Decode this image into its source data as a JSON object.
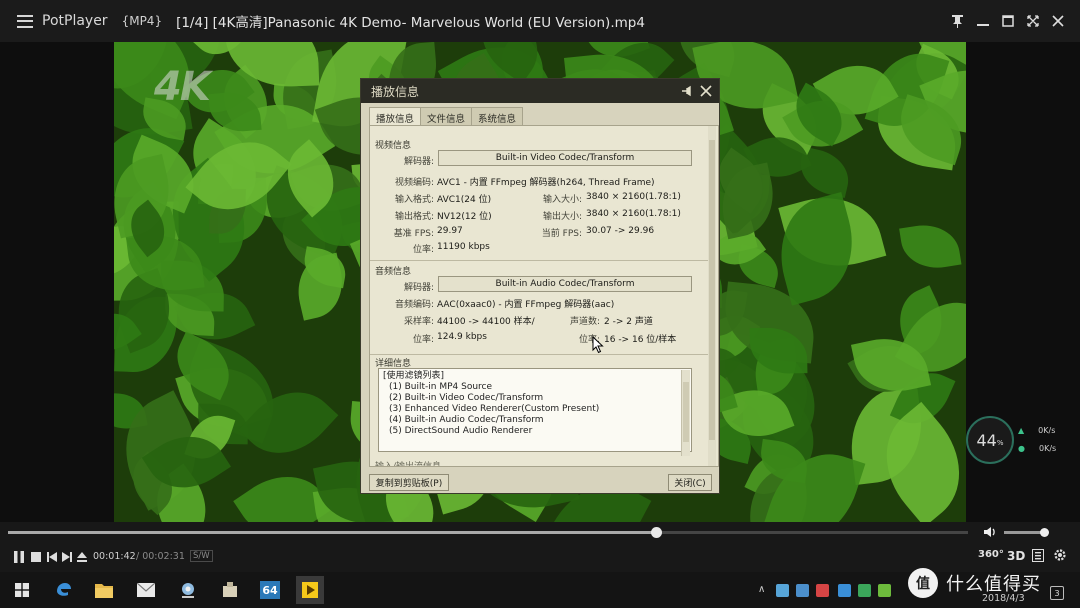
{
  "window": {
    "app_name": "PotPlayer",
    "format_tag": "{MP4}",
    "file_title": "[1/4] [4K高清]Panasonic 4K Demo- Marvelous World (EU Version).mp4"
  },
  "video": {
    "watermark": "4K"
  },
  "dialog": {
    "title": "播放信息",
    "tabs": [
      "播放信息",
      "文件信息",
      "系统信息"
    ],
    "video_section": {
      "title": "视频信息",
      "decoder_label": "解码器:",
      "decoder_value": "Built-in Video Codec/Transform",
      "codec_label": "视频编码:",
      "codec_value": "AVC1 - 内置 FFmpeg 解码器(h264, Thread Frame)",
      "in_format_label": "输入格式:",
      "in_format_value": "AVC1(24 位)",
      "in_size_label": "输入大小:",
      "in_size_value": "3840 × 2160(1.78:1)",
      "out_format_label": "输出格式:",
      "out_format_value": "NV12(12 位)",
      "out_size_label": "输出大小:",
      "out_size_value": "3840 × 2160(1.78:1)",
      "base_fps_label": "基准 FPS:",
      "base_fps_value": "29.97",
      "cur_fps_label": "当前 FPS:",
      "cur_fps_value": "30.07 -> 29.96",
      "bitrate_label": "位率:",
      "bitrate_value": "11190 kbps"
    },
    "audio_section": {
      "title": "音频信息",
      "decoder_label": "解码器:",
      "decoder_value": "Built-in Audio Codec/Transform",
      "codec_label": "音频编码:",
      "codec_value": "AAC(0xaac0) - 内置 FFmpeg 解码器(aac)",
      "samplerate_label": "采样率:",
      "samplerate_value": "44100 -> 44100 样本/",
      "channels_label": "声道数:",
      "channels_value": "2 -> 2 声道",
      "bitrate_label": "位率:",
      "bitrate_value": "124.9 kbps",
      "bits_label": "位率:",
      "bits_value": "16 -> 16 位/样本"
    },
    "detail_section": {
      "title": "详细信息",
      "lines": [
        "[使用滤镜列表]",
        "(1) Built-in MP4 Source",
        "(2) Built-in Video Codec/Transform",
        "(3) Enhanced Video Renderer(Custom Present)",
        "(4) Built-in Audio Codec/Transform",
        "(5) DirectSound Audio Renderer"
      ]
    },
    "truncated_section_title": "输入/输出流信息",
    "copy_button": "复制到剪贴板(P)",
    "close_button": "关闭(C)"
  },
  "speed_widget": {
    "percent": "44",
    "percent_unit": "%",
    "up_rate": "0K/s",
    "down_rate": "0K/s"
  },
  "playback": {
    "current_time": "00:01:42",
    "total_time": "/ 00:02:31",
    "decode_tag": "S/W",
    "progress": 0.675,
    "volume": 0.95,
    "btn_360": "360°",
    "btn_3d": "3D"
  },
  "taskbar": {
    "date": "2018/4/3",
    "badge_64": "64",
    "notification_count": "3"
  },
  "brand": {
    "badge": "值",
    "text": "什么值得买"
  },
  "colors": {
    "dialog_bg": "#d7d3bd",
    "dialog_title_bg": "#2b2b24",
    "leaf_green": "#3c8a1a",
    "accent_teal": "#2b6f5c"
  }
}
